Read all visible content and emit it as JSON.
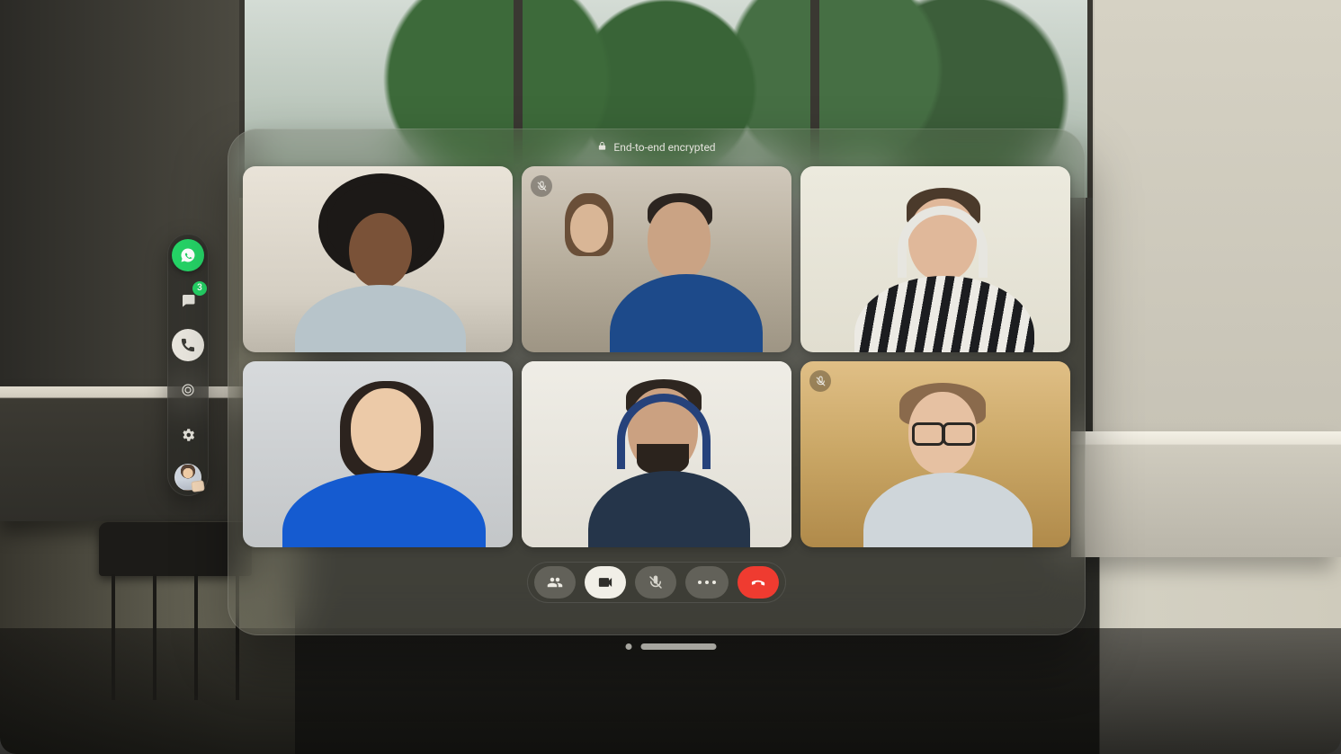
{
  "header": {
    "encryption_label": "End-to-end encrypted"
  },
  "sidebar": {
    "app_icon": "whatsapp-icon",
    "chats_badge": "3",
    "active_tab": "calls"
  },
  "participants": [
    {
      "id": 1,
      "muted": false,
      "speaking": false
    },
    {
      "id": 2,
      "muted": true,
      "speaking": false
    },
    {
      "id": 3,
      "muted": false,
      "speaking": false
    },
    {
      "id": 4,
      "muted": false,
      "speaking": false
    },
    {
      "id": 5,
      "muted": false,
      "speaking": true
    },
    {
      "id": 6,
      "muted": true,
      "speaking": false
    }
  ],
  "toolbar": {
    "camera_on": true,
    "mic_muted": true
  },
  "colors": {
    "brand_green": "#25D366",
    "hangup_red": "#ef3b30",
    "active_pill": "#f1efe7"
  }
}
